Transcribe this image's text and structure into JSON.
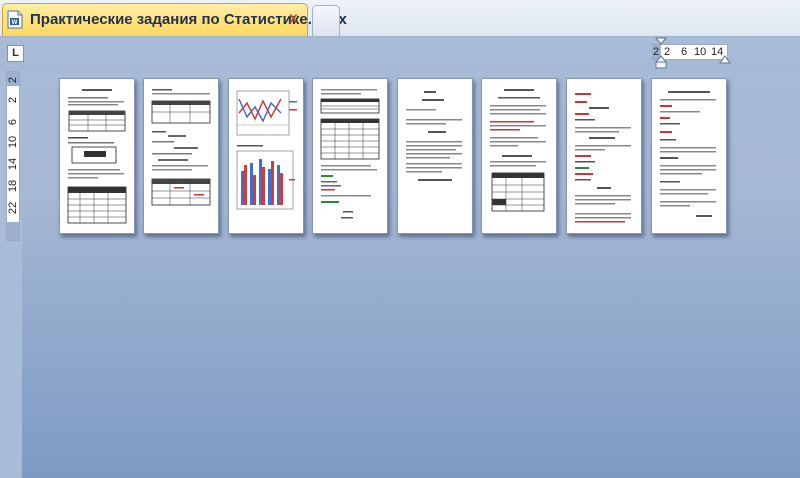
{
  "tab": {
    "title": "Практические задания по Статистике.docx",
    "close_glyph": "x"
  },
  "ruler": {
    "selector_glyph": "L",
    "horizontal_ticks": [
      "2",
      "2",
      "6",
      "10",
      "14"
    ],
    "vertical_ticks": [
      "2",
      "2",
      "6",
      "10",
      "14",
      "18",
      "22"
    ]
  },
  "pages": [
    {
      "index": 1,
      "kind": "tables"
    },
    {
      "index": 2,
      "kind": "table-and-formulas"
    },
    {
      "index": 3,
      "kind": "charts"
    },
    {
      "index": 4,
      "kind": "dense-tables"
    },
    {
      "index": 5,
      "kind": "formulas"
    },
    {
      "index": 6,
      "kind": "text-and-table"
    },
    {
      "index": 7,
      "kind": "formulas-red"
    },
    {
      "index": 8,
      "kind": "text-formulas"
    }
  ],
  "colors": {
    "tab_active": "#ffd75e",
    "canvas_top": "#a7bad6",
    "canvas_bottom": "#7e9ac4"
  }
}
